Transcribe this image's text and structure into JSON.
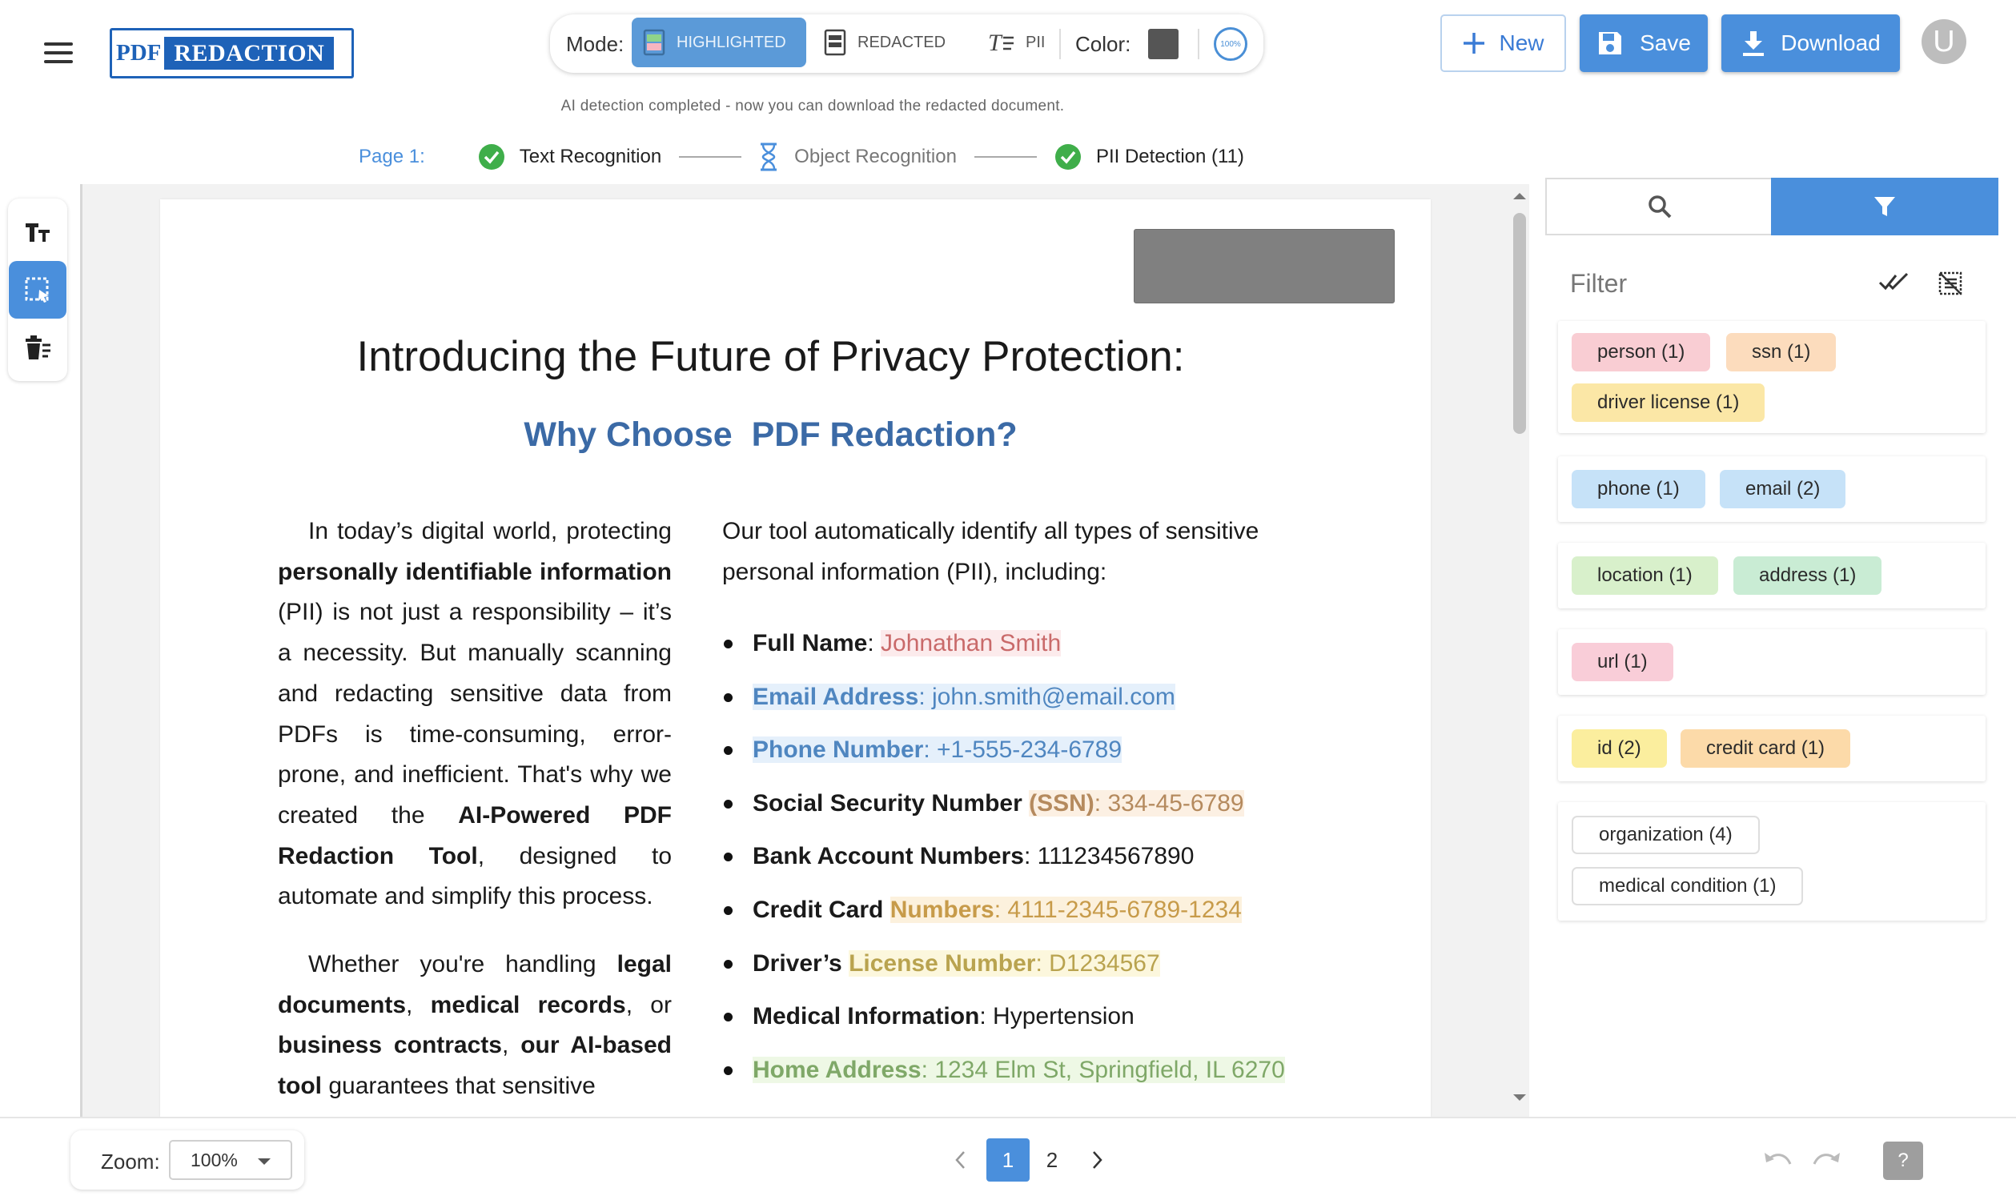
{
  "app": {
    "logo_pdf": "PDF",
    "logo_redaction": "REDACTION"
  },
  "mode_bar": {
    "mode_label": "Mode:",
    "modes": [
      "HIGHLIGHTED",
      "REDACTED",
      "PII"
    ],
    "active_mode": "HIGHLIGHTED",
    "color_label": "Color:",
    "color_value": "#555555",
    "zoom_badge": "100%"
  },
  "actions": {
    "new_label": "New",
    "save_label": "Save",
    "download_label": "Download",
    "avatar_initial": "U"
  },
  "status_message": "AI detection completed - now you can download the redacted document.",
  "progress": {
    "page_label": "Page 1:",
    "steps": [
      {
        "label": "Text Recognition",
        "state": "done"
      },
      {
        "label": "Object Recognition",
        "state": "pending"
      },
      {
        "label": "PII Detection (11)",
        "state": "done"
      }
    ]
  },
  "toolbar": {
    "tools": [
      "text-tool-icon",
      "area-select-icon",
      "clear-redactions-icon"
    ],
    "active_tool": "area-select-icon"
  },
  "document": {
    "title": "Introducing the Future of Privacy Protection:",
    "subtitle": "Why Choose  PDF Redaction?",
    "left_p1": [
      "In today’s digital world, protecting ",
      "personally identifiable information",
      " (PII) is not just a responsibility – it’s a necessity. But manually scanning and redacting sensitive data from PDFs is time-consuming, error-prone, and inefficient. That's why we created the ",
      "AI-Powered PDF Redaction Tool",
      ", designed to automate and simplify this process."
    ],
    "left_p2": [
      "Whether you're handling ",
      "legal documents",
      ", ",
      "medical records",
      ", or ",
      "business contracts",
      ", ",
      "our AI-based tool",
      " guarantees that sensitive"
    ],
    "right_intro": "Our tool automatically identify all types of sensitive personal information (PII), including:",
    "bullets": {
      "full_name": {
        "label": "Full Name",
        "sep": ": ",
        "value": "Johnathan Smith"
      },
      "email": {
        "label": "Email Address",
        "sep": ": ",
        "value": "john.smith@email.com"
      },
      "phone": {
        "label": "Phone Number",
        "sep": ": ",
        "value": "+1-555-234-6789"
      },
      "ssn": {
        "label": "Social Security Number ",
        "label_hl": "(SSN)",
        "sep": ": ",
        "value": "334-45-6789"
      },
      "bank": {
        "label": "Bank Account Numbers",
        "sep": ": ",
        "value": "111234567890"
      },
      "credit_card": {
        "label": "Credit Card ",
        "label_hl": "Numbers",
        "sep": ": ",
        "value": "4111-2345-6789-1234"
      },
      "driver_license": {
        "label_a": "Driver’s ",
        "label_hl": "License Number",
        "sep": ": ",
        "value": "D1234567"
      },
      "medical": {
        "label": "Medical Information",
        "sep": ": ",
        "value": "Hypertension"
      },
      "home_address": {
        "label": "Home Address",
        "sep": ": ",
        "value": "1234 Elm St, Springfield, IL 6270"
      }
    }
  },
  "filter_panel": {
    "filter_label": "Filter",
    "groups": [
      [
        "person (1)",
        "ssn (1)",
        "driver license (1)"
      ],
      [
        "phone (1)",
        "email (2)"
      ],
      [
        "location (1)",
        "address (1)"
      ],
      [
        "url (1)"
      ],
      [
        "id (2)",
        "credit card (1)"
      ],
      [
        "organization (4)",
        "medical condition (1)"
      ]
    ]
  },
  "bottom": {
    "zoom_label": "Zoom:",
    "zoom_value": "100%",
    "pages": [
      "1",
      "2"
    ],
    "current_page": "1",
    "help_label": "?"
  },
  "colors": {
    "accent": "#4a8fdc",
    "heading_blue": "#3b6aa6",
    "success_green": "#3fae4a"
  }
}
